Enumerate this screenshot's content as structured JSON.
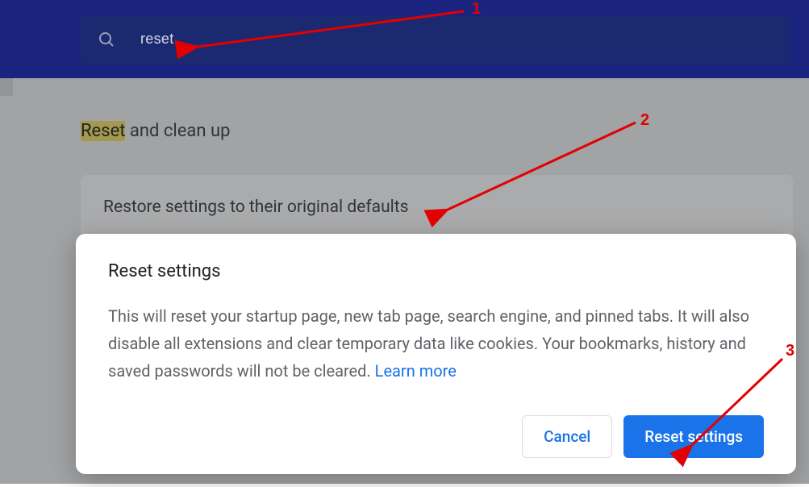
{
  "search": {
    "value": "reset"
  },
  "section": {
    "title_highlight": "Reset",
    "title_rest": " and clean up",
    "row_restore": "Restore settings to their original defaults"
  },
  "dialog": {
    "title": "Reset settings",
    "body_text": "This will reset your startup page, new tab page, search engine, and pinned tabs. It will also disable all extensions and clear temporary data like cookies. Your bookmarks, history and saved passwords will not be cleared. ",
    "learn_more": "Learn more",
    "cancel": "Cancel",
    "confirm": "Reset settings"
  },
  "annotations": {
    "a1": "1",
    "a2": "2",
    "a3": "3"
  }
}
